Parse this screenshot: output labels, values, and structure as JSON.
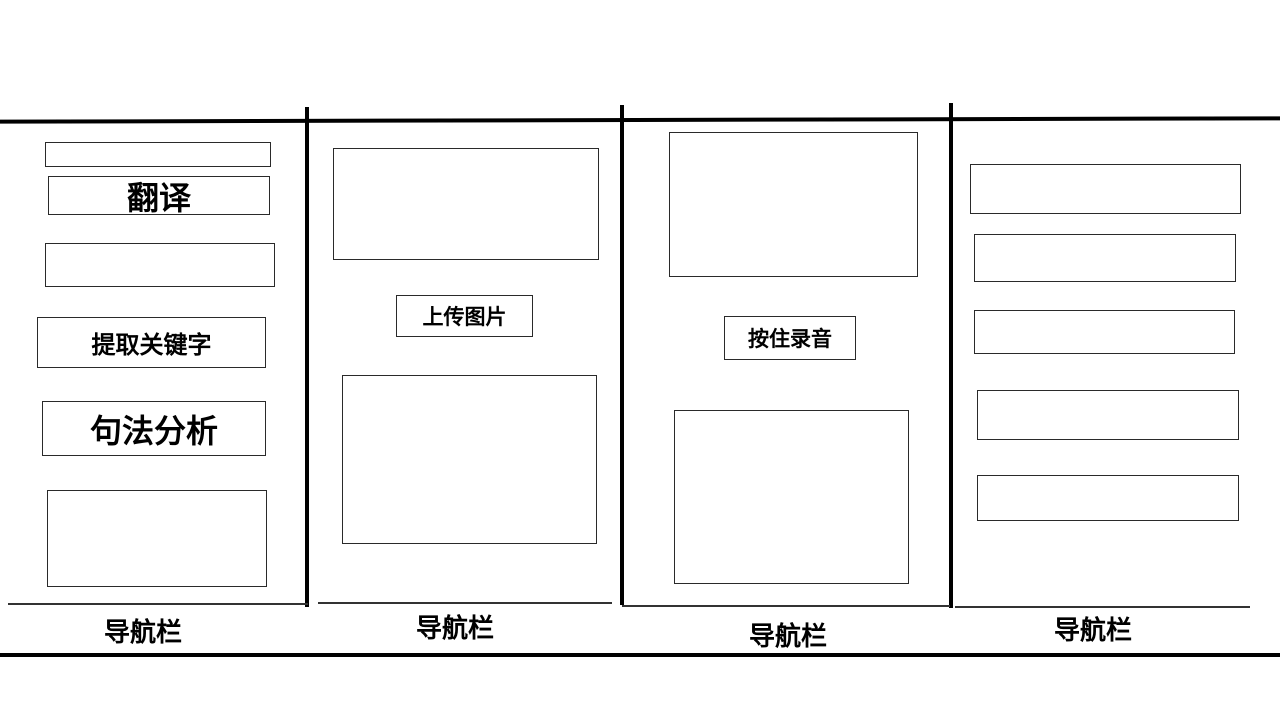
{
  "screen1": {
    "translate_button": "翻译",
    "keywords_button": "提取关键字",
    "syntax_button": "句法分析",
    "navbar_label": "导航栏"
  },
  "screen2": {
    "upload_button": "上传图片",
    "navbar_label": "导航栏"
  },
  "screen3": {
    "record_button": "按住录音",
    "navbar_label": "导航栏"
  },
  "screen4": {
    "navbar_label": "导航栏"
  }
}
